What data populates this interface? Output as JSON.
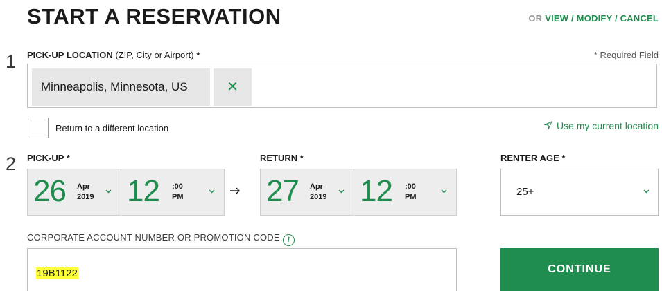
{
  "header": {
    "title": "START A RESERVATION",
    "or_text": "OR",
    "modify_link": "VIEW / MODIFY / CANCEL"
  },
  "step1": {
    "number": "1",
    "label": "PICK-UP LOCATION",
    "hint": "(ZIP, City or Airport)",
    "required_star": "*",
    "required_note": "* Required Field",
    "location_value": "Minneapolis, Minnesota, US",
    "clear_glyph": "✕",
    "return_different_label": "Return to a different location",
    "use_current_location": "Use my current location"
  },
  "step2": {
    "number": "2",
    "pickup": {
      "label": "PICK-UP *",
      "day": "26",
      "month": "Apr",
      "year": "2019",
      "hour": "12",
      "minute": ":00",
      "ampm": "PM"
    },
    "return": {
      "label": "RETURN *",
      "day": "27",
      "month": "Apr",
      "year": "2019",
      "hour": "12",
      "minute": ":00",
      "ampm": "PM"
    },
    "renter_age": {
      "label": "RENTER AGE *",
      "value": "25+"
    }
  },
  "promo": {
    "label": "CORPORATE ACCOUNT NUMBER OR PROMOTION CODE",
    "info_glyph": "i",
    "value": "19B1122"
  },
  "continue_label": "CONTINUE",
  "icons": {
    "chevron": "chevron-down-icon",
    "arrow": "arrow-right-icon",
    "location": "location-arrow-icon",
    "close": "close-icon",
    "info": "info-icon"
  },
  "colors": {
    "accent_green": "#1e8d4e",
    "highlight_yellow": "#ffff3a",
    "chip_gray": "#e6e6e6"
  }
}
